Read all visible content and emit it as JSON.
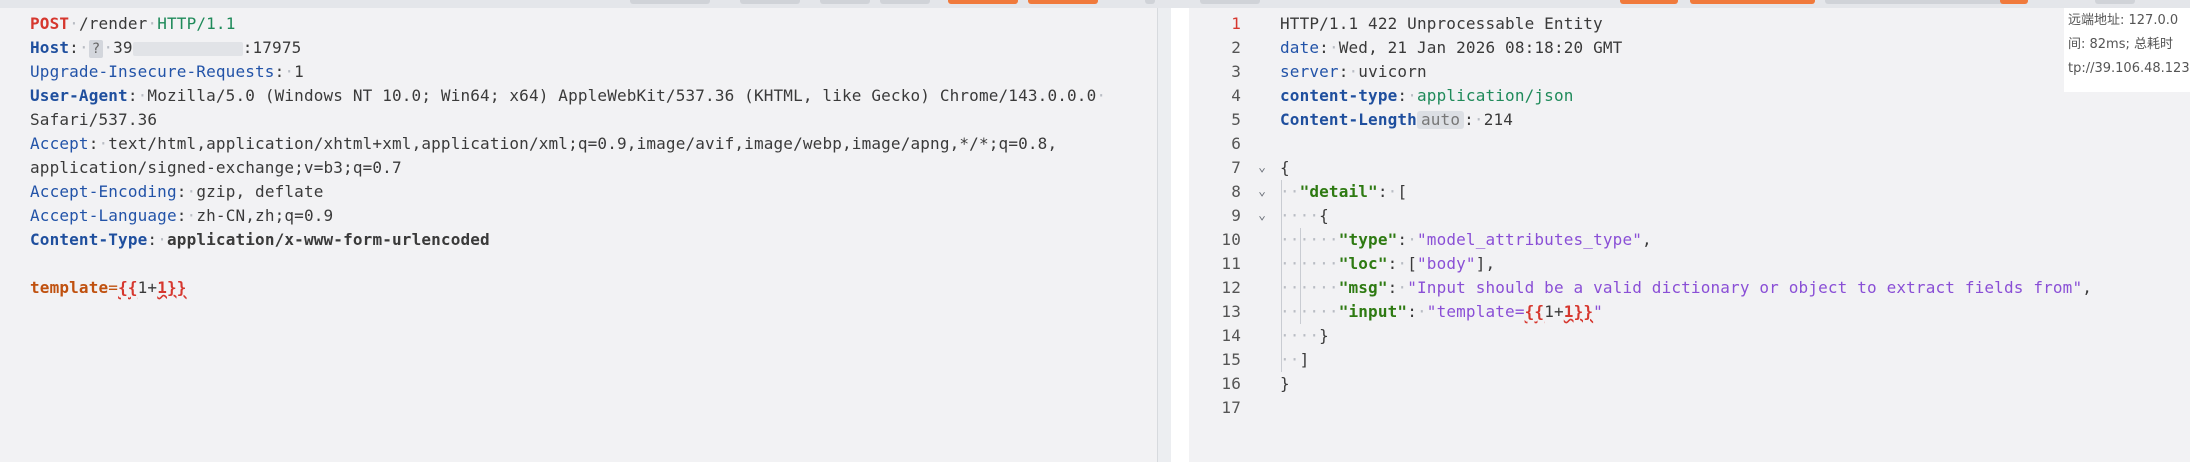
{
  "request": {
    "method": "POST",
    "path": "/render",
    "protocol": "HTTP/1.1",
    "headers": [
      {
        "name": "Host",
        "value_prefix": "39",
        "value_suffix": ":17975",
        "redaction_mark": "?"
      },
      {
        "name": "Upgrade-Insecure-Requests",
        "value": "1"
      },
      {
        "name": "User-Agent",
        "value": "Mozilla/5.0 (Windows NT 10.0; Win64; x64) AppleWebKit/537.36 (KHTML, like Gecko) Chrome/143.0.0.0",
        "value_cont": "Safari/537.36"
      },
      {
        "name": "Accept",
        "value": "text/html,application/xhtml+xml,application/xml;q=0.9,image/avif,image/webp,image/apng,*/*;q=0.8,",
        "value_cont": "application/signed-exchange;v=b3;q=0.7"
      },
      {
        "name": "Accept-Encoding",
        "value": "gzip, deflate"
      },
      {
        "name": "Accept-Language",
        "value": "zh-CN,zh;q=0.9"
      },
      {
        "name": "Content-Type",
        "value": "application/x-www-form-urlencoded"
      }
    ],
    "body": {
      "param": "template",
      "eq": "=",
      "open": "{{",
      "expr": "1+",
      "num": "1",
      "close": "}}"
    }
  },
  "response": {
    "line_numbers": [
      "1",
      "2",
      "3",
      "4",
      "5",
      "6",
      "7",
      "8",
      "9",
      "10",
      "11",
      "12",
      "13",
      "14",
      "15",
      "16",
      "17"
    ],
    "status_line": "HTTP/1.1 422 Unprocessable Entity",
    "headers": [
      {
        "name": "date",
        "value": "Wed, 21 Jan 2026 08:18:20 GMT"
      },
      {
        "name": "server",
        "value": "uvicorn"
      },
      {
        "name": "content-type",
        "value": "application/json"
      },
      {
        "name": "Content-Length",
        "badge": "auto",
        "value": "214"
      }
    ],
    "json": {
      "open_brace": "{",
      "detail_key": "\"detail\"",
      "open_bracket": "[",
      "obj_open": "{",
      "type_key": "\"type\"",
      "type_val": "\"model_attributes_type\"",
      "loc_key": "\"loc\"",
      "loc_open": "[",
      "loc_val": "\"body\"",
      "loc_close": "],",
      "msg_key": "\"msg\"",
      "msg_val": "\"Input should be a valid dictionary or object to extract fields from\"",
      "input_key": "\"input\"",
      "input_val_prefix": "\"template=",
      "input_open": "{{",
      "input_expr": "1+",
      "input_num": "1",
      "input_close": "}}",
      "input_val_suffix": "\"",
      "obj_close": "}",
      "close_bracket": "]",
      "close_brace": "}"
    }
  },
  "side_info": {
    "line1": "远端地址:  127.0.0",
    "line2": "间: 82ms; 总耗时",
    "line3": "tp://39.106.48.123:"
  },
  "colors": {
    "method": "#d6372e",
    "header_key": "#2253a8",
    "json_key": "#2e7a12",
    "json_string": "#8a4fd6",
    "param": "#c0510f",
    "accent_toolbar": "#f07a3c"
  },
  "icons": {
    "fold": "chevron-down-icon"
  }
}
